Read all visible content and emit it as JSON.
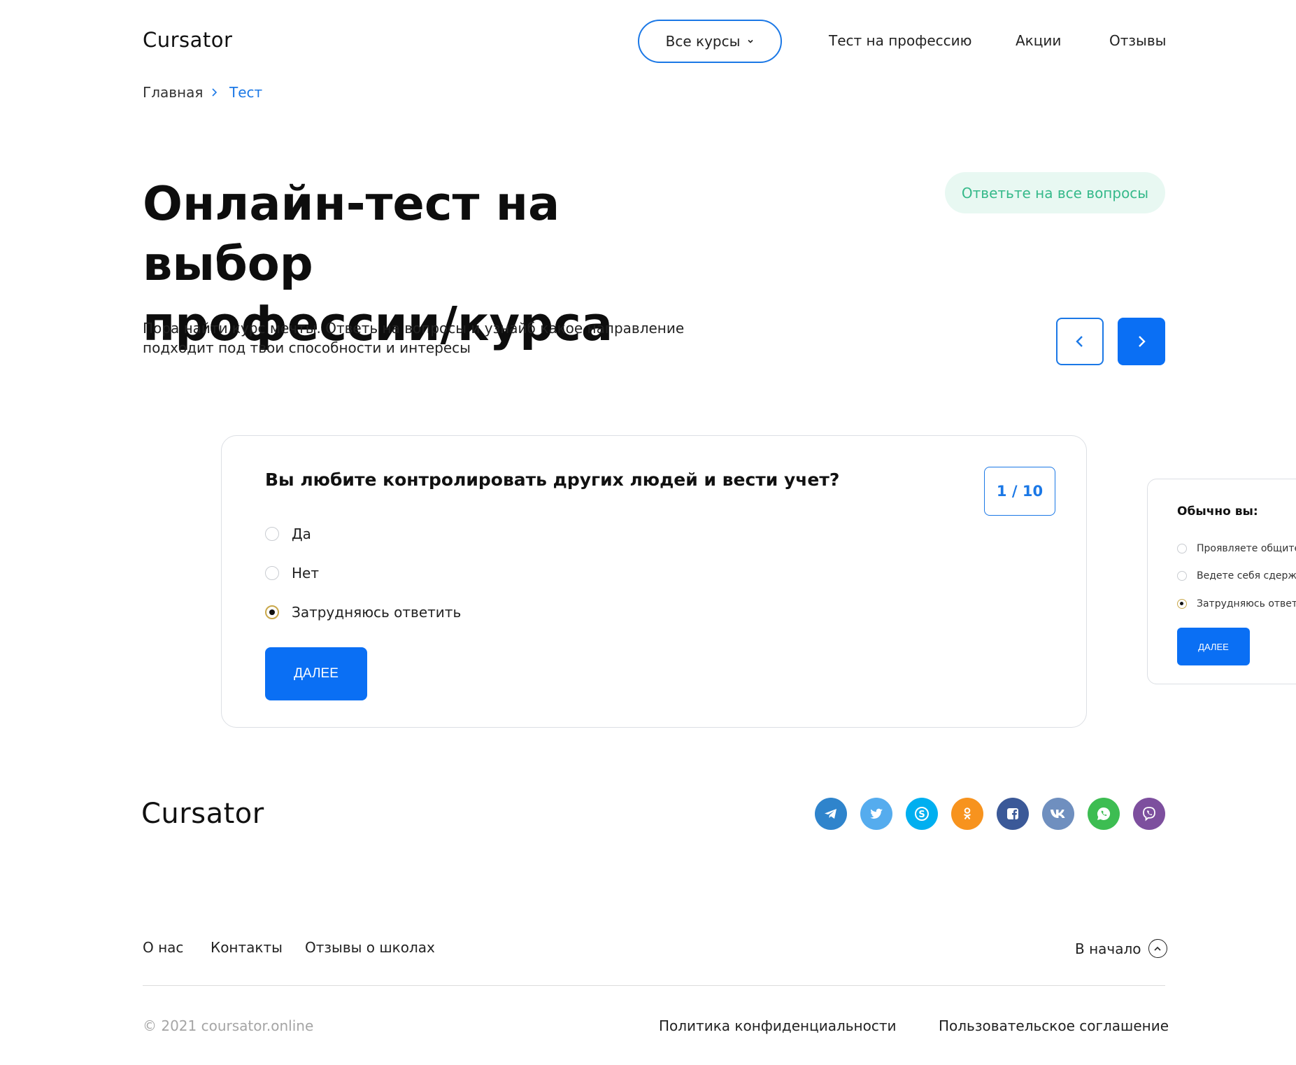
{
  "header": {
    "logo": "Cursator",
    "courses_button": "Все курсы",
    "nav": [
      "Тест на профессию",
      "Акции",
      "Отзывы"
    ]
  },
  "breadcrumb": {
    "home": "Главная",
    "current": "Тест"
  },
  "hero": {
    "title_line1": "Онлайн-тест на выбор",
    "title_line2": "профессии/курса",
    "badge": "Ответьте на все вопросы",
    "subtitle_line1": "Пора найти курс мечты. Ответь на вопросы и узнайб какое направление",
    "subtitle_line2": "подходит под твои способности и интересы"
  },
  "quiz": {
    "question": "Вы любите контролировать других людей и вести учет?",
    "counter": "1 / 10",
    "options": [
      "Да",
      "Нет",
      "Затрудняюсь ответить"
    ],
    "selected_option": "Затрудняюсь ответить",
    "next_button": "ДАЛЕЕ"
  },
  "quiz_next": {
    "question": "Обычно вы:",
    "options": [
      "Проявляете общите",
      "Ведете себя сдержа",
      "Затрудняюсь ответи"
    ],
    "selected_option": "Затрудняюсь ответи",
    "next_button": "ДАЛЕЕ"
  },
  "footer": {
    "logo": "Cursator",
    "social": [
      {
        "name": "telegram-icon",
        "color": "#2f84cc"
      },
      {
        "name": "twitter-icon",
        "color": "#55acee"
      },
      {
        "name": "skype-icon",
        "color": "#00aff0"
      },
      {
        "name": "odnoklassniki-icon",
        "color": "#f7931e"
      },
      {
        "name": "facebook-icon",
        "color": "#3b5998"
      },
      {
        "name": "vk-icon",
        "color": "#6f8fbf"
      },
      {
        "name": "whatsapp-icon",
        "color": "#3dbd52"
      },
      {
        "name": "viber-icon",
        "color": "#7d4f9e"
      }
    ],
    "links": [
      "О нас",
      "Контакты",
      "Отзывы о школах"
    ],
    "to_top": "В начало",
    "copyright": "© 2021 coursator.online",
    "privacy": "Политика конфиденциальности",
    "terms": "Пользовательское соглашение"
  },
  "colors": {
    "accent": "#0a6ff4",
    "link": "#1b78e6",
    "badge_bg": "#e8f8f2",
    "badge_text": "#35b98a"
  }
}
